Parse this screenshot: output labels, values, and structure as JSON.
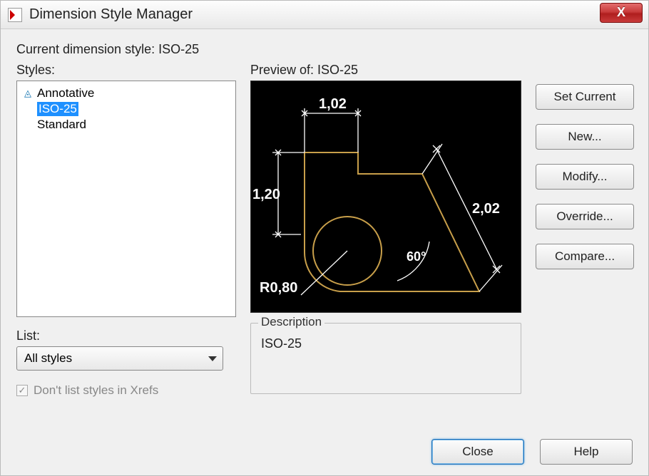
{
  "title": "Dimension Style Manager",
  "current_label_prefix": "Current dimension style: ",
  "current_style": "ISO-25",
  "styles_label": "Styles:",
  "styles": [
    "Annotative",
    "ISO-25",
    "Standard"
  ],
  "selected_style_index": 1,
  "annotative_marker_index": 0,
  "preview_label_prefix": "Preview of: ",
  "preview_style": "ISO-25",
  "preview_dims": {
    "top": "1,02",
    "left": "1,20",
    "diag": "2,02",
    "angle": "60°",
    "radius": "R0,80"
  },
  "description_legend": "Description",
  "description_text": "ISO-25",
  "buttons": {
    "set_current": "Set Current",
    "new": "New...",
    "modify": "Modify...",
    "override": "Override...",
    "compare": "Compare..."
  },
  "list_label": "List:",
  "list_value": "All styles",
  "xref_checkbox_label": "Don't list styles in Xrefs",
  "xref_checked": true,
  "footer": {
    "close": "Close",
    "help": "Help"
  }
}
